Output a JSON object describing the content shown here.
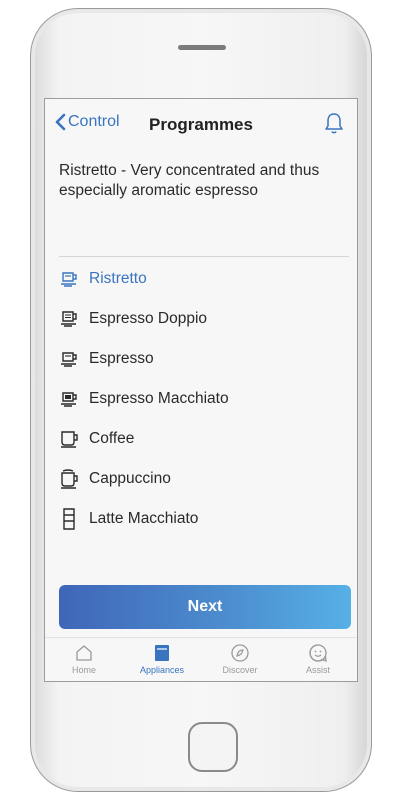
{
  "header": {
    "back_label": "Control",
    "title": "Programmes"
  },
  "description": "Ristretto - Very concentrated and thus especially aromatic espresso",
  "programmes": [
    {
      "label": "Ristretto",
      "icon": "ristretto-cup-icon",
      "selected": true
    },
    {
      "label": "Espresso Doppio",
      "icon": "espresso-doppio-cup-icon",
      "selected": false
    },
    {
      "label": "Espresso",
      "icon": "espresso-cup-icon",
      "selected": false
    },
    {
      "label": "Espresso Macchiato",
      "icon": "espresso-macchiato-cup-icon",
      "selected": false
    },
    {
      "label": "Coffee",
      "icon": "coffee-cup-icon",
      "selected": false
    },
    {
      "label": "Cappuccino",
      "icon": "cappuccino-cup-icon",
      "selected": false
    },
    {
      "label": "Latte Macchiato",
      "icon": "latte-glass-icon",
      "selected": false
    }
  ],
  "next_label": "Next",
  "tabs": [
    {
      "label": "Home",
      "icon": "home-icon",
      "active": false
    },
    {
      "label": "Appliances",
      "icon": "appliances-icon",
      "active": true
    },
    {
      "label": "Discover",
      "icon": "compass-icon",
      "active": false
    },
    {
      "label": "Assist",
      "icon": "smiley-icon",
      "active": false
    }
  ],
  "colors": {
    "accent": "#3a74c0",
    "text": "#2a2a2a",
    "inactive": "#9a9a9a"
  }
}
